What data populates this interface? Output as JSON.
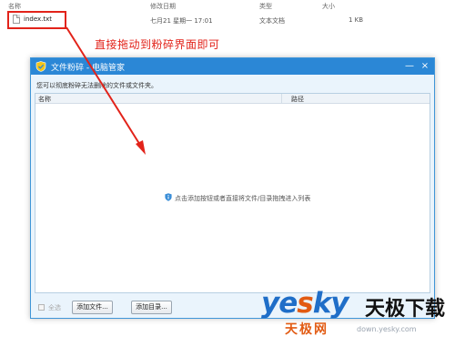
{
  "explorer": {
    "columns": {
      "name": "名称",
      "modified": "修改日期",
      "type": "类型",
      "size": "大小"
    },
    "file": {
      "name": "index.txt",
      "modified": "七月21 星期一 17:01",
      "type": "文本文档",
      "size": "1 KB"
    }
  },
  "annotation": "直接拖动到粉碎界面即可",
  "window": {
    "title": "文件粉碎 - 电脑管家",
    "subtitle": "您可以彻底粉碎无法删除的文件或文件夹。",
    "list_headers": {
      "name": "名称",
      "path": "路径"
    },
    "empty_hint": "点击添加按钮或者直接将文件/目录拖拽进入列表",
    "select_all": "全选",
    "add_file": "添加文件...",
    "add_dir": "添加目录...",
    "minimize_glyph": "—",
    "close_glyph": "×"
  },
  "watermark": {
    "brand_a": "ye",
    "brand_b": "s",
    "brand_c": "ky",
    "cn": "天极下载",
    "cn2": "天极网",
    "url": "down.yesky.com"
  },
  "colors": {
    "accent": "#2b87d6",
    "annotation": "#e2231a",
    "logo_blue": "#1f6ec8",
    "logo_orange": "#e25b13"
  }
}
